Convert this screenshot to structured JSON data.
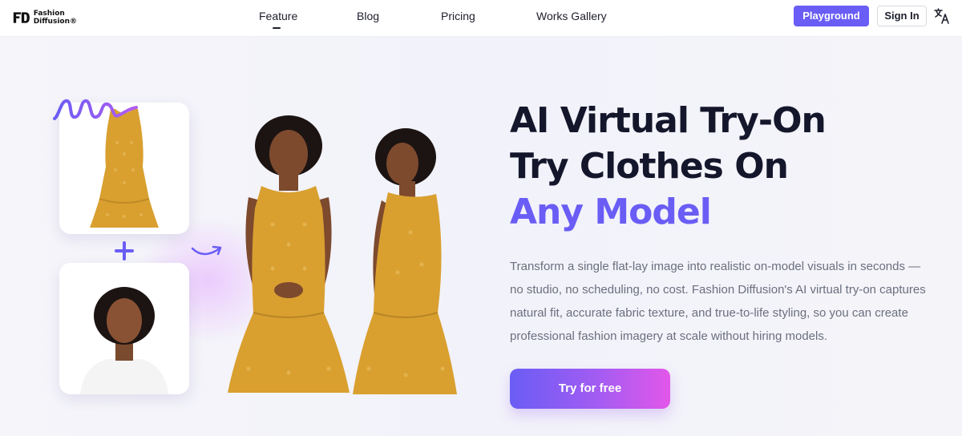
{
  "nav": {
    "logo_text_line1": "Fashion",
    "logo_text_line2": "Diffusion®",
    "links": [
      "Feature",
      "Blog",
      "Pricing",
      "Works Gallery"
    ],
    "active_link": "Feature",
    "playground_label": "Playground",
    "signin_label": "Sign In",
    "language_icon": "translate-icon"
  },
  "hero": {
    "title_line1": "AI Virtual Try-On",
    "title_line2": "Try Clothes On",
    "title_line3": "Any Model",
    "description": "Transform a single flat-lay image into realistic on-model visuals in seconds — no studio, no scheduling, no cost. Fashion Diffusion's AI virtual try-on captures natural fit, accurate fabric texture, and true-to-life styling, so you can create professional fashion imagery at scale without hiring models.",
    "cta_label": "Try for free",
    "icons": [
      "squiggle-icon",
      "plus-icon",
      "curved-arrow-icon"
    ]
  },
  "colors": {
    "accent": "#6a5df5",
    "cta_gradient_end": "#e257e9",
    "dress": "#d9a030",
    "heading": "#14162b",
    "body_text": "#6b6f7e"
  }
}
